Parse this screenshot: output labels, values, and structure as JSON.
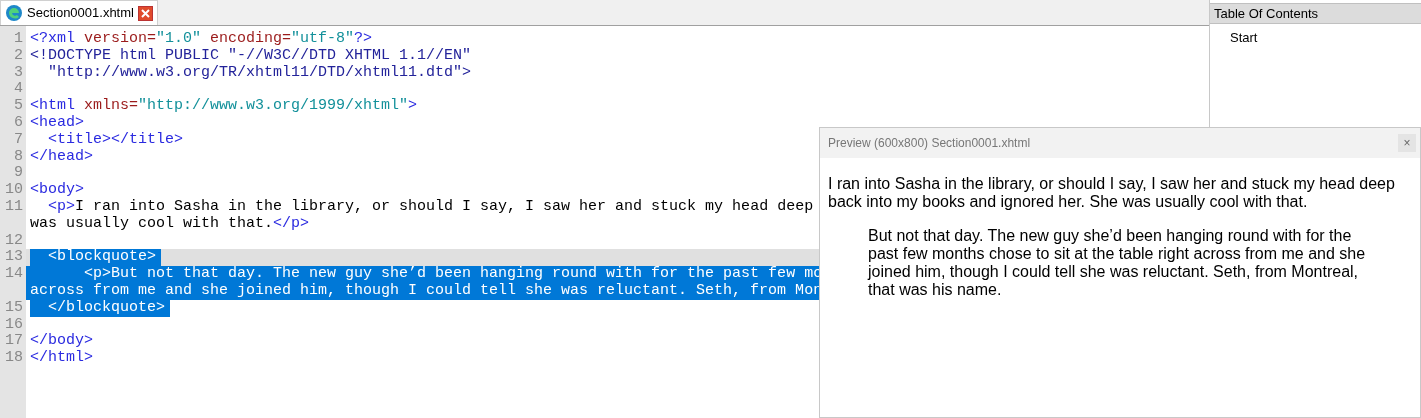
{
  "tab": {
    "title": "Section0001.xhtml",
    "selected": true
  },
  "editor": {
    "lines": [
      {
        "number": "1",
        "selected": false,
        "rows": [
          {
            "tokens": [
              {
                "text": "<?xml",
                "kind": "tag"
              },
              {
                "text": " version=",
                "kind": "attr"
              },
              {
                "text": "\"1.0\"",
                "kind": "value"
              },
              {
                "text": " encoding=",
                "kind": "attr"
              },
              {
                "text": "\"utf-8\"",
                "kind": "value"
              },
              {
                "text": "?>",
                "kind": "tag"
              }
            ]
          }
        ]
      },
      {
        "number": "2",
        "selected": false,
        "rows": [
          {
            "tokens": [
              {
                "text": "<!DOCTYPE html PUBLIC \"-//W3C//DTD XHTML 1.1//EN\"",
                "kind": "doctype"
              }
            ]
          }
        ]
      },
      {
        "number": "3",
        "selected": false,
        "rows": [
          {
            "tokens": [
              {
                "text": "  \"http://www.w3.org/TR/xhtml11/DTD/xhtml11.dtd\">",
                "kind": "doctype"
              }
            ]
          }
        ]
      },
      {
        "number": "4",
        "selected": false
      },
      {
        "number": "5",
        "selected": false,
        "rows": [
          {
            "tokens": [
              {
                "text": "<html",
                "kind": "tag"
              },
              {
                "text": " xmlns=",
                "kind": "attr"
              },
              {
                "text": "\"http://www.w3.org/1999/xhtml\"",
                "kind": "value"
              },
              {
                "text": ">",
                "kind": "tag"
              }
            ]
          }
        ]
      },
      {
        "number": "6",
        "selected": false,
        "rows": [
          {
            "tokens": [
              {
                "text": "<head>",
                "kind": "tag"
              }
            ]
          }
        ]
      },
      {
        "number": "7",
        "selected": false,
        "rows": [
          {
            "tokens": [
              {
                "text": "  <title></title>",
                "kind": "tag"
              }
            ]
          }
        ]
      },
      {
        "number": "8",
        "selected": false,
        "rows": [
          {
            "tokens": [
              {
                "text": "</head>",
                "kind": "tag"
              }
            ]
          }
        ]
      },
      {
        "number": "9",
        "selected": false
      },
      {
        "number": "10",
        "selected": false,
        "rows": [
          {
            "tokens": [
              {
                "text": "<body>",
                "kind": "tag"
              }
            ]
          }
        ]
      },
      {
        "number": "11",
        "selected": false,
        "rows": [
          {
            "tokens": [
              {
                "text": "  <p>",
                "kind": "tag"
              },
              {
                "text": "I ran into Sasha in the library, or should I say, I saw her and stuck my head deep",
                "kind": "text"
              }
            ]
          },
          {
            "tokens": [
              {
                "text": "was usually cool with that.",
                "kind": "text"
              },
              {
                "text": "</p>",
                "kind": "tag"
              }
            ]
          }
        ]
      },
      {
        "number": "12",
        "selected": false
      },
      {
        "number": "13",
        "selected": true,
        "selected_to_edge": false,
        "current": true,
        "rows": [
          {
            "tokens": [
              {
                "text": "  <blockquote>",
                "kind": "tag"
              }
            ]
          }
        ]
      },
      {
        "number": "14",
        "selected": true,
        "selected_to_edge": true,
        "rows": [
          {
            "tokens": [
              {
                "text": "      <p>",
                "kind": "tag"
              },
              {
                "text": "But not that day. The new guy she’d been hanging round with for the past few mo",
                "kind": "text"
              }
            ]
          },
          {
            "tokens": [
              {
                "text": "across from me and she joined him, though I could tell she was reluctant. Seth, from Mon",
                "kind": "text"
              }
            ]
          }
        ]
      },
      {
        "number": "15",
        "selected": true,
        "selected_to_edge": false,
        "rows": [
          {
            "tokens": [
              {
                "text": "  </blockquote>",
                "kind": "tag"
              }
            ]
          }
        ]
      },
      {
        "number": "16",
        "selected": false
      },
      {
        "number": "17",
        "selected": false,
        "rows": [
          {
            "tokens": [
              {
                "text": "</body>",
                "kind": "tag"
              }
            ]
          }
        ]
      },
      {
        "number": "18",
        "selected": false,
        "rows": [
          {
            "tokens": [
              {
                "text": "</html>",
                "kind": "tag"
              }
            ]
          }
        ]
      }
    ]
  },
  "table_of_contents": {
    "title": "Table Of Contents",
    "items": [
      {
        "label": "Start",
        "selected": false
      }
    ]
  },
  "preview": {
    "title": "Preview (600x800) Section0001.xhtml",
    "close": "×",
    "paragraphs": [
      {
        "kind": "paragraph",
        "text": "I ran into Sasha in the library, or should I say, I saw her and stuck my head deep back into my books and ignored her. She was usually cool with that."
      },
      {
        "kind": "blockquote",
        "text": "But not that day. The new guy she’d been hanging round with for the past few months chose to sit at the table right across from me and she joined him, though I could tell she was reluctant. Seth, from Montreal, that was his name."
      }
    ]
  }
}
